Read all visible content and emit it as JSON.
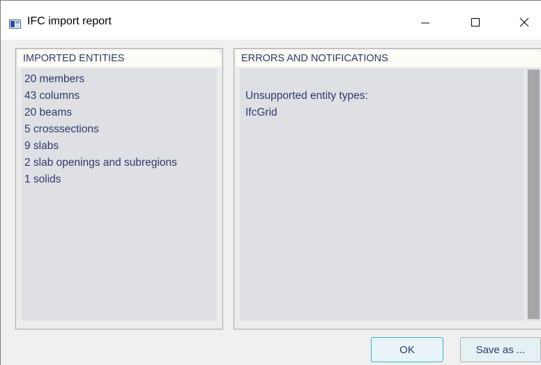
{
  "window": {
    "title": "IFC import report",
    "icon": "app-window-icon",
    "controls": {
      "minimize_icon": "minimize-icon",
      "maximize_icon": "maximize-icon",
      "close_icon": "close-icon"
    }
  },
  "imported_panel": {
    "header": "IMPORTED ENTITIES",
    "items": [
      "20 members",
      "43 columns",
      "20 beams",
      "5 crosssections",
      "9 slabs",
      "2 slab openings and subregions",
      "1 solids"
    ]
  },
  "errors_panel": {
    "header": "ERRORS AND NOTIFICATIONS",
    "lines": [
      "",
      "Unsupported entity types:",
      "IfcGrid"
    ]
  },
  "buttons": {
    "ok_label": "OK",
    "save_as_label": "Save as ..."
  },
  "colors": {
    "text": "#2e3870",
    "panel_bg": "#dfe0e3",
    "header_bg": "#fdfbf5",
    "ok_border": "#33b3c8"
  }
}
